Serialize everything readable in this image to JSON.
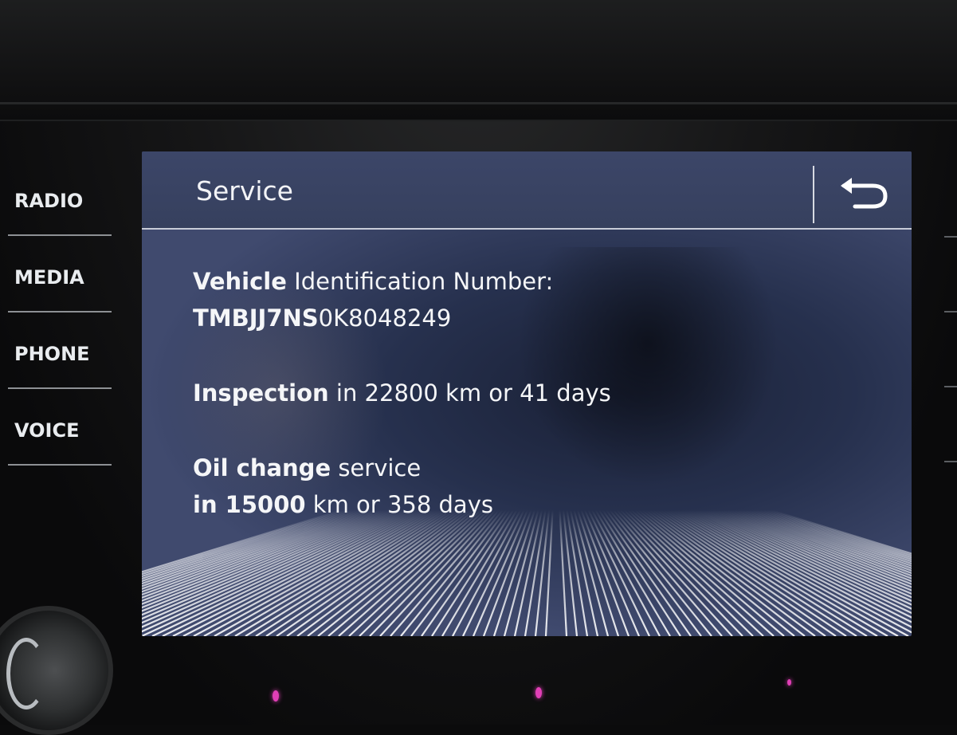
{
  "hardware_buttons": [
    {
      "label": "RADIO"
    },
    {
      "label": "MEDIA"
    },
    {
      "label": "PHONE"
    },
    {
      "label": "VOICE"
    }
  ],
  "screen": {
    "title": "Service",
    "back_icon": "back-arrow-icon",
    "vin": {
      "label": "Vehicle Identification Number:",
      "label_bold": "Vehicle",
      "label_rest": "Identification Number:",
      "value": "TMBJJ7NS0K8048249",
      "value_bold": "TMBJJ7NS",
      "value_rest": "0K8048249"
    },
    "inspection": {
      "bold": "Inspection",
      "rest": "in 22800 km or 41 days"
    },
    "oil_change": {
      "line1_bold": "Oil change",
      "line1_rest": "service",
      "line2_bold": "in 15000",
      "line2_rest": "km or 358 days"
    }
  },
  "colors": {
    "screen_bg": "#3b4670",
    "header_bg": "#3c4668",
    "text": "#f5f6f8",
    "ambient": "#e13fb6"
  }
}
